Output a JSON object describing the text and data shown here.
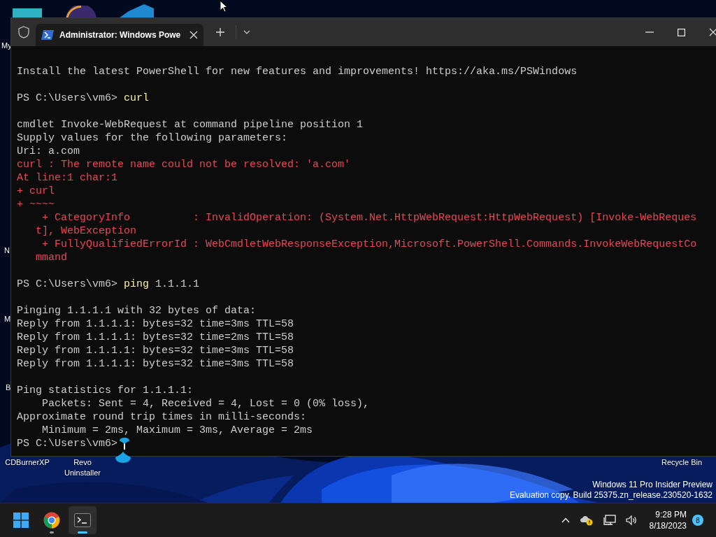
{
  "desktop": {
    "icon_labels": [
      {
        "text": "My"
      },
      {
        "text": "N"
      },
      {
        "text": "M"
      },
      {
        "text": "B"
      },
      {
        "text": "CDBurnerXP"
      },
      {
        "text": "Revo Uninstaller"
      },
      {
        "text": "Recycle Bin"
      }
    ]
  },
  "window": {
    "tab": {
      "title": "Administrator: Windows Powe",
      "selected": true
    }
  },
  "terminal": {
    "lines": [
      {
        "kind": "output",
        "text": "Install the latest PowerShell for new features and improvements! https://aka.ms/PSWindows"
      },
      {
        "kind": "blank"
      },
      {
        "kind": "prompt",
        "prompt": "PS C:\\Users\\vm6>",
        "command": "curl"
      },
      {
        "kind": "blank"
      },
      {
        "kind": "output",
        "text": "cmdlet Invoke-WebRequest at command pipeline position 1"
      },
      {
        "kind": "output",
        "text": "Supply values for the following parameters:"
      },
      {
        "kind": "output",
        "text": "Uri: a.com"
      },
      {
        "kind": "error",
        "text": "curl : The remote name could not be resolved: 'a.com'"
      },
      {
        "kind": "error",
        "text": "At line:1 char:1"
      },
      {
        "kind": "error",
        "text": "+ curl"
      },
      {
        "kind": "error",
        "text": "+ ~~~~"
      },
      {
        "kind": "error",
        "text": "    + CategoryInfo          : InvalidOperation: (System.Net.HttpWebRequest:HttpWebRequest) [Invoke-WebReques"
      },
      {
        "kind": "error",
        "text": "   t], WebException"
      },
      {
        "kind": "error",
        "text": "    + FullyQualifiedErrorId : WebCmdletWebResponseException,Microsoft.PowerShell.Commands.InvokeWebRequestCo"
      },
      {
        "kind": "error",
        "text": "   mmand"
      },
      {
        "kind": "blank"
      },
      {
        "kind": "prompt",
        "prompt": "PS C:\\Users\\vm6>",
        "command": "ping",
        "args": "1.1.1.1"
      },
      {
        "kind": "blank"
      },
      {
        "kind": "output",
        "text": "Pinging 1.1.1.1 with 32 bytes of data:"
      },
      {
        "kind": "output",
        "text": "Reply from 1.1.1.1: bytes=32 time=3ms TTL=58"
      },
      {
        "kind": "output",
        "text": "Reply from 1.1.1.1: bytes=32 time=2ms TTL=58"
      },
      {
        "kind": "output",
        "text": "Reply from 1.1.1.1: bytes=32 time=3ms TTL=58"
      },
      {
        "kind": "output",
        "text": "Reply from 1.1.1.1: bytes=32 time=3ms TTL=58"
      },
      {
        "kind": "blank"
      },
      {
        "kind": "output",
        "text": "Ping statistics for 1.1.1.1:"
      },
      {
        "kind": "output",
        "text": "    Packets: Sent = 4, Received = 4, Lost = 0 (0% loss),"
      },
      {
        "kind": "output",
        "text": "Approximate round trip times in milli-seconds:"
      },
      {
        "kind": "output",
        "text": "    Minimum = 2ms, Maximum = 3ms, Average = 2ms"
      },
      {
        "kind": "prompt",
        "prompt": "PS C:\\Users\\vm6>",
        "cursor": true
      }
    ]
  },
  "watermark": [
    "Windows 11 Pro Insider Preview",
    "Evaluation copy. Build 25375.zn_release.230520-1632"
  ],
  "taskbar": {
    "apps": [
      {
        "kind": "start",
        "selected": false,
        "running": false
      },
      {
        "kind": "chrome",
        "selected": false,
        "running": true
      },
      {
        "kind": "terminal",
        "selected": true,
        "running": true
      }
    ],
    "clock": {
      "time": "9:28 PM",
      "date": "8/18/2023"
    },
    "notification_count": "8"
  }
}
